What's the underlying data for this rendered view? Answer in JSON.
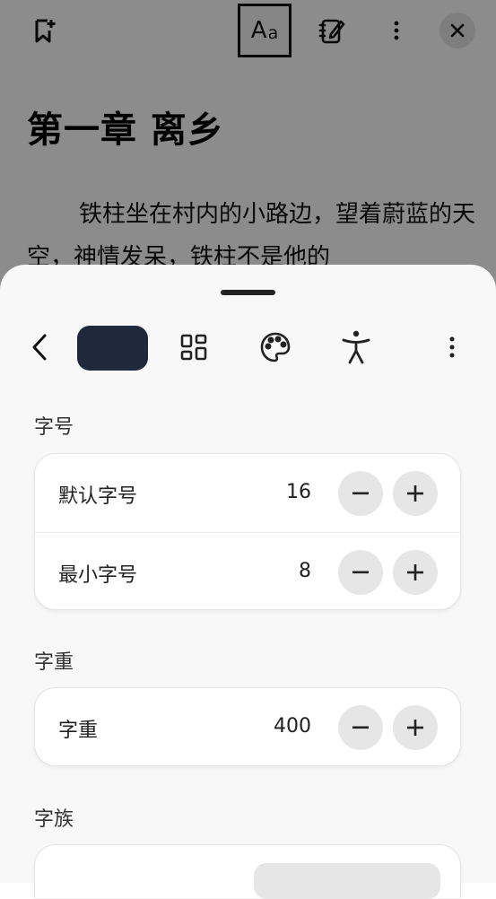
{
  "reader": {
    "chapter_title": "第一章 离乡",
    "paragraph": "铁柱坐在村内的小路边，望着蔚蓝的天空，神情发呆，铁柱不是他的"
  },
  "topbar": {
    "bookmark_icon": "bookmark-add-icon",
    "font_icon": "font-size-icon",
    "font_icon_big": "A",
    "font_icon_small": "a",
    "notes_icon": "notebook-edit-icon",
    "more_icon": "more-vertical-icon",
    "close_icon": "close-icon"
  },
  "sheet": {
    "toolbar": {
      "back_icon": "chevron-left-icon",
      "active_tab_icon": "text-tab",
      "layout_icon": "layout-grid-icon",
      "palette_icon": "palette-icon",
      "accessibility_icon": "accessibility-icon",
      "more_icon": "more-vertical-icon"
    },
    "font_size": {
      "section_label": "字号",
      "rows": [
        {
          "label": "默认字号",
          "value": "16"
        },
        {
          "label": "最小字号",
          "value": "8"
        }
      ]
    },
    "font_weight": {
      "section_label": "字重",
      "rows": [
        {
          "label": "字重",
          "value": "400"
        }
      ]
    },
    "font_family": {
      "section_label": "字族"
    }
  },
  "colors": {
    "active_tab": "#1e293b",
    "stepper_bg": "#e6e6e6",
    "sheet_bg": "#f8f8f8"
  }
}
